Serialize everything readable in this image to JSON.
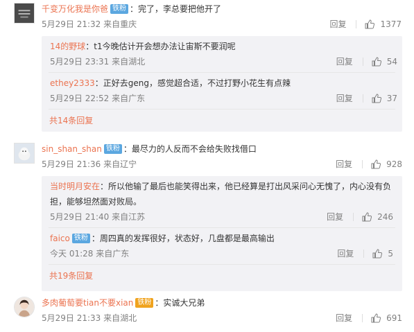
{
  "comments": [
    {
      "user": "千变万化我是你爸",
      "badge": "铁粉",
      "text": "：完了，李总要把他开了",
      "time": "5月29日 21:32 来自重庆",
      "reply_label": "回复",
      "likes": "1377",
      "replies": [
        {
          "user": "14的野球",
          "text": "：t1今晚估计开会想办法让宙斯不要润呢",
          "time": "5月29日 23:31 来自湖北",
          "reply_label": "回复",
          "likes": "54"
        },
        {
          "user": "ethey2333",
          "text": "：正好去geng，感觉超合适，不过打野小花生有点辣",
          "time": "5月29日 22:52 来自广东",
          "reply_label": "回复",
          "likes": "37"
        }
      ],
      "more": "共14条回复"
    },
    {
      "user": "sin_shan_shan",
      "badge": "铁粉",
      "text": "：最尽力的人反而不会给失败找借口",
      "time": "5月29日 21:36 来自辽宁",
      "reply_label": "回复",
      "likes": "928",
      "replies": [
        {
          "user": "当时明月安在",
          "text_line1": "：所以他输了最后也能笑得出来，他已经算是打出风采问心无愧了，内心没有负",
          "text_line2": "担，能够坦然面对败局。",
          "time": "5月29日 21:40 来自江苏",
          "reply_label": "回复",
          "likes": "246"
        },
        {
          "user": "faico",
          "badge": "铁粉",
          "text": "：周四真的发挥很好，状态好，几盘都是最高输出",
          "time": "今天 01:28 来自广东",
          "reply_label": "回复",
          "likes": "5"
        }
      ],
      "more": "共19条回复"
    },
    {
      "user": "多肉葡萄要tian不要xian",
      "badge": "铁粉",
      "text": "：实诚大兄弟",
      "time": "5月29日 21:33 来自湖北",
      "reply_label": "回复",
      "likes": "691"
    }
  ],
  "icons": {
    "like": "thumbs-up-icon"
  },
  "colors": {
    "name": "#eb7350",
    "badge": "#5ba7e0",
    "gray": "#808080",
    "sub_bg": "#f2f2f5"
  }
}
